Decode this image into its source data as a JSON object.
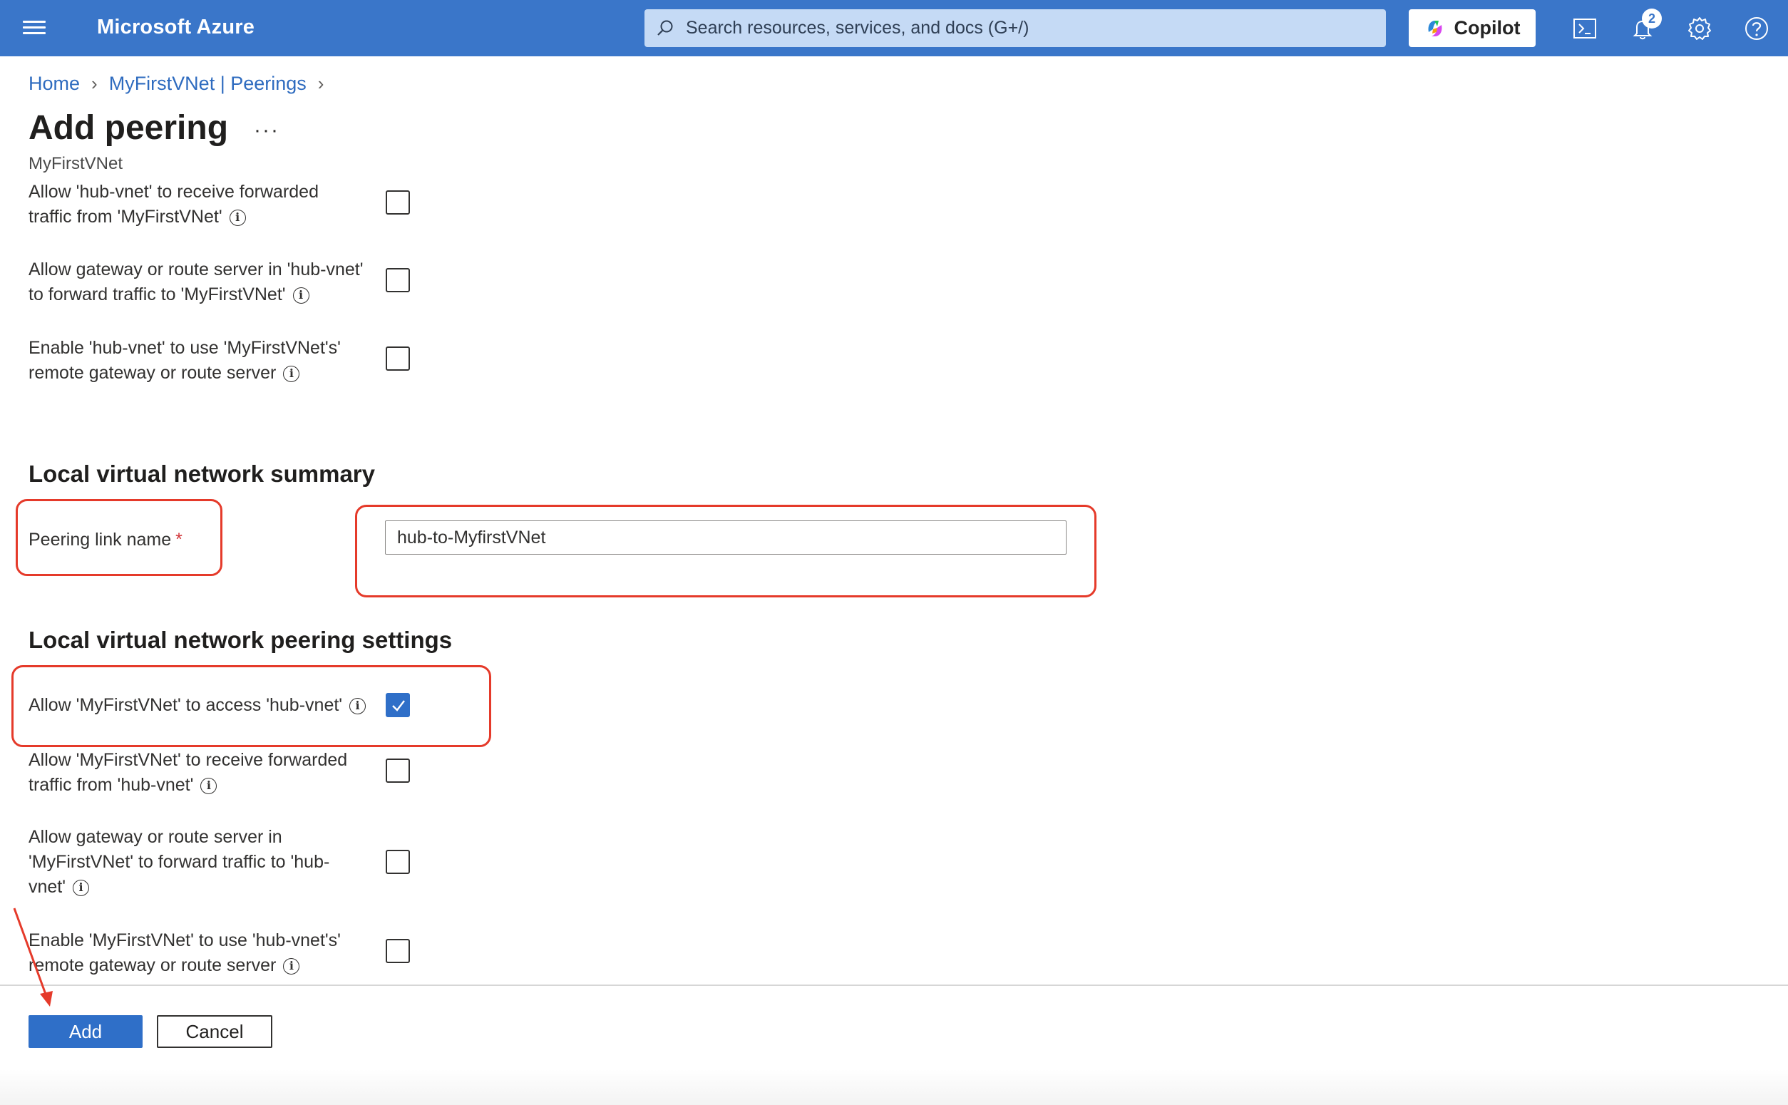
{
  "topbar": {
    "brand": "Microsoft Azure",
    "search_placeholder": "Search resources, services, and docs (G+/)",
    "copilot_label": "Copilot",
    "notification_count": "2",
    "bg_color": "#3a76c9"
  },
  "breadcrumb": {
    "home": "Home",
    "peerings": "MyFirstVNet | Peerings"
  },
  "header": {
    "title": "Add peering",
    "more": "···",
    "subtitle": "MyFirstVNet"
  },
  "remote_settings": {
    "items": [
      {
        "line1": "Allow 'hub-vnet' to receive forwarded",
        "line2": "traffic from 'MyFirstVNet'",
        "checked": false
      },
      {
        "line1": "Allow gateway or route server in 'hub-vnet'",
        "line2": "to forward traffic to 'MyFirstVNet'",
        "checked": false
      },
      {
        "line1": "Enable 'hub-vnet' to use 'MyFirstVNet's'",
        "line2": "remote gateway or route server",
        "checked": false
      }
    ]
  },
  "local_summary": {
    "title": "Local virtual network summary",
    "peering_link_label": "Peering link name",
    "required_mark": "*",
    "peering_link_value": "hub-to-MyfirstVNet"
  },
  "local_settings": {
    "title": "Local virtual network peering settings",
    "items": [
      {
        "line1": "Allow 'MyFirstVNet' to access 'hub-vnet'",
        "checked": true
      },
      {
        "line1": "Allow 'MyFirstVNet' to receive forwarded",
        "line2": "traffic from 'hub-vnet'",
        "checked": false
      },
      {
        "line1": "Allow gateway or route server in",
        "line2": "'MyFirstVNet' to forward traffic to 'hub-",
        "line3": "vnet'",
        "checked": false
      },
      {
        "line1": "Enable 'MyFirstVNet' to use 'hub-vnet's'",
        "line2": "remote gateway or route server",
        "checked": false
      }
    ]
  },
  "footer": {
    "add_label": "Add",
    "cancel_label": "Cancel"
  },
  "colors": {
    "primary": "#2f6fc8",
    "callout": "#e53a2a"
  }
}
